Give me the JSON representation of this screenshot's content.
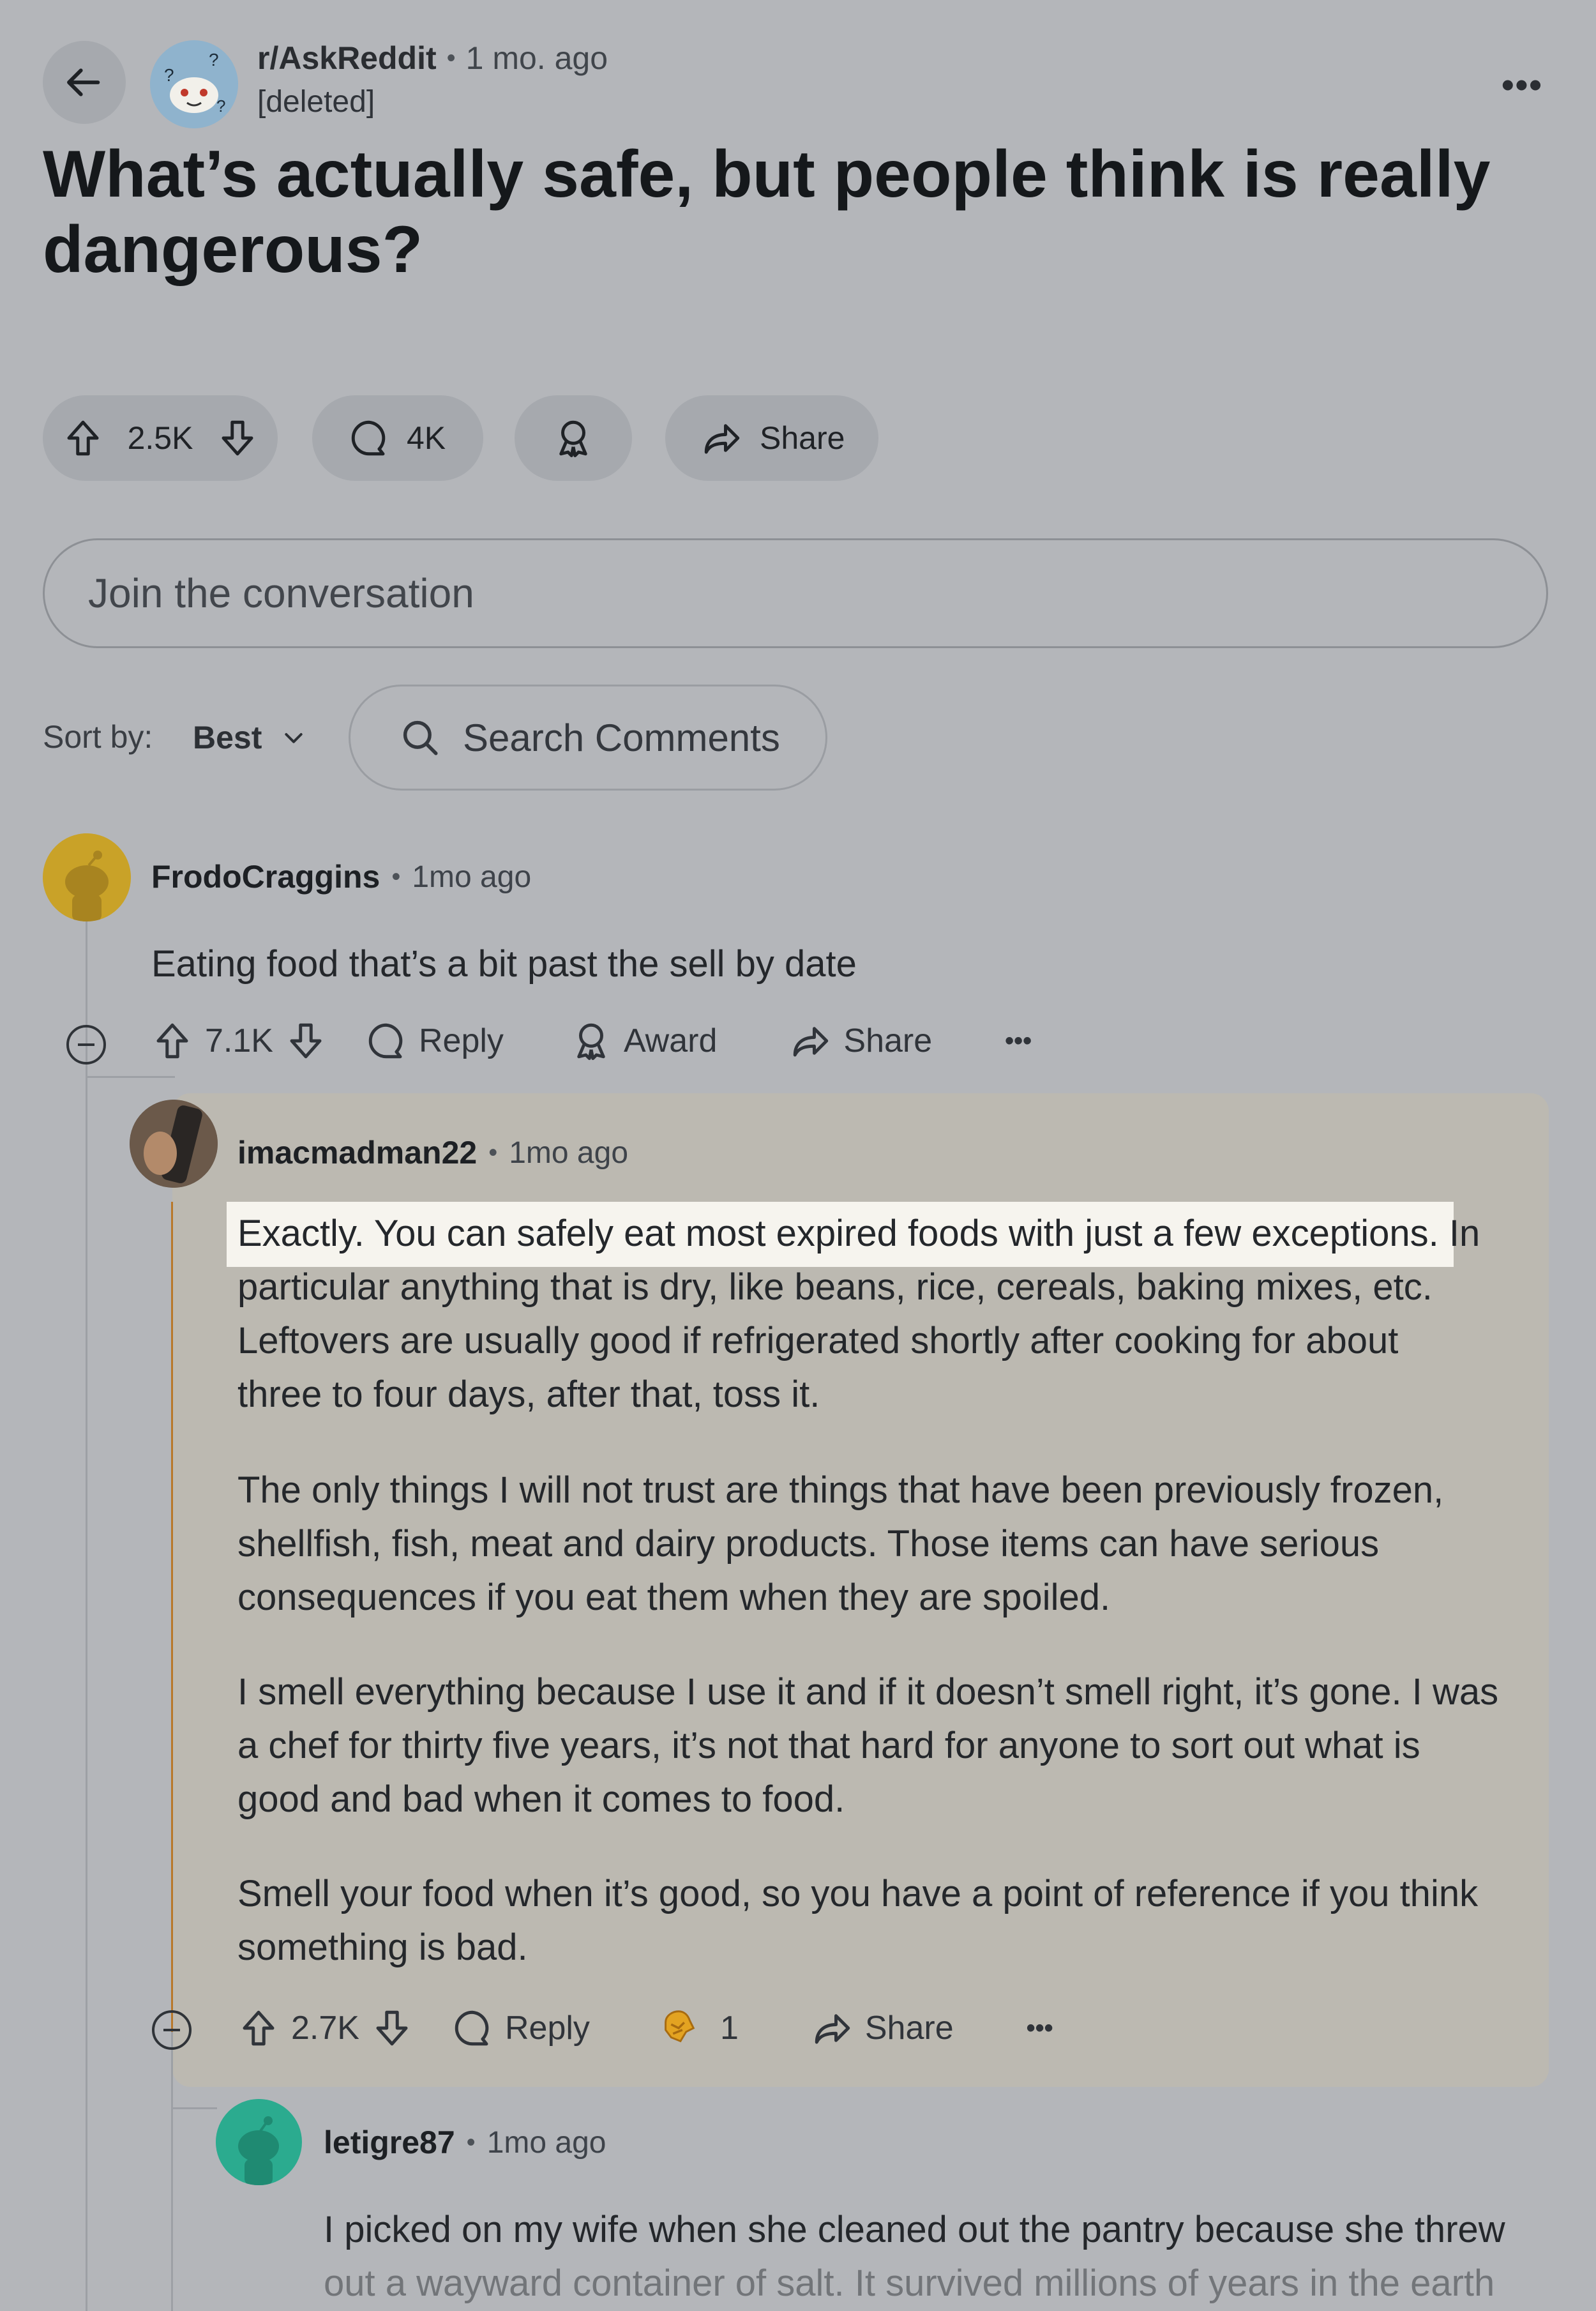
{
  "post": {
    "subreddit": "r/AskReddit",
    "age": "1 mo. ago",
    "author": "[deleted]",
    "title": "What’s actually safe, but people think is really dangerous?",
    "votes": "2.5K",
    "comments": "4K",
    "share_label": "Share"
  },
  "composer": {
    "placeholder": "Join the conversation"
  },
  "sort": {
    "label": "Sort by:",
    "value": "Best",
    "search_label": "Search Comments"
  },
  "comments": [
    {
      "author": "FrodoCraggins",
      "age": "1mo ago",
      "paragraphs": [
        "Eating food that’s a bit past the sell by date"
      ],
      "votes": "7.1K",
      "reply_label": "Reply",
      "award_label": "Award",
      "share_label": "Share"
    },
    {
      "author": "imacmadman22",
      "age": "1mo ago",
      "lines": [
        "Exactly. You can safely eat most expired foods with just a few exceptions. In",
        "particular anything that is dry, like beans, rice, cereals, baking mixes, etc.",
        "Leftovers are usually good if refrigerated shortly after cooking for about",
        "three to four days, after that, toss it.",
        "The only things I will not trust are things that have been previously frozen,",
        "shellfish, fish, meat and dairy products. Those items can have serious",
        "consequences if you eat them when they are spoiled.",
        "I smell everything because I use it and if it doesn’t smell right, it’s gone. I was",
        "a chef for thirty five years, it’s not that hard for anyone to sort out what is",
        "good and bad when it comes to food.",
        "Smell your food when it’s good, so you have a point of reference if you think",
        "something is bad."
      ],
      "votes": "2.7K",
      "reply_label": "Reply",
      "award_count": "1",
      "share_label": "Share"
    },
    {
      "author": "letigre87",
      "age": "1mo ago",
      "lines": [
        "I picked on my wife when she cleaned out the pantry because she threw",
        "out a wayward container of salt. It survived millions of years in the earth"
      ]
    }
  ],
  "colors": {
    "background": "#b4b6ba",
    "reply_card": "#bcb9b1",
    "highlight": "#f6f4ee",
    "thread_accent": "#b8782a",
    "avatar_gold": "#c9a228",
    "avatar_teal": "#2bab8f"
  },
  "icons": {
    "back": "arrow-left-icon",
    "upvote": "arrow-up-outline-icon",
    "downvote": "arrow-down-outline-icon",
    "comment": "speech-bubble-icon",
    "award": "award-ribbon-icon",
    "share": "share-arrow-icon",
    "search": "magnifier-icon",
    "collapse": "minus-circle-icon",
    "more": "ellipsis-icon",
    "chevron": "chevron-down-icon"
  }
}
